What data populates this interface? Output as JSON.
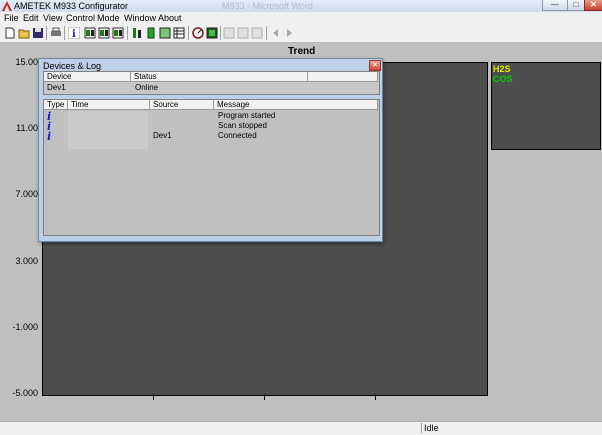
{
  "window": {
    "title": "AMETEK M933 Configurator",
    "ghost_title": "M933 - Microsoft Word",
    "minimize": "—",
    "maximize": "□",
    "close": "✕"
  },
  "menu": [
    "File",
    "Edit",
    "View",
    "Control",
    "Mode",
    "Window",
    "About"
  ],
  "toolbar": {
    "icons": [
      "new-file-icon",
      "open-folder-icon",
      "save-icon",
      "print-icon",
      "info-icon",
      "channel-1-icon",
      "channel-2-icon",
      "channel-3-icon",
      "bar-chart-icon",
      "green-cell-icon",
      "table-icon",
      "grid-icon",
      "gauge-icon",
      "analyzer-icon",
      "disabled-a-icon",
      "disabled-b-icon",
      "disabled-c-icon",
      "left-arrow-icon",
      "right-arrow-icon"
    ]
  },
  "chart": {
    "title": "Trend",
    "y_ticks": [
      "15.00",
      "11.00",
      "7.000",
      "3.000",
      "-1.000",
      "-5.000"
    ],
    "background": "#4d4d4d"
  },
  "legend": [
    {
      "label": "H2S",
      "color": "#e6e600"
    },
    {
      "label": "COS",
      "color": "#00d000"
    }
  ],
  "status": {
    "state": "Idle"
  },
  "dialog": {
    "title": "Devices & Log",
    "close": "✕",
    "devices": {
      "headers": [
        "Device",
        "Status"
      ],
      "rows": [
        {
          "device": "Dev1",
          "status": "Online"
        }
      ]
    },
    "log": {
      "headers": [
        "Type",
        "Time",
        "Source",
        "Message"
      ],
      "rows": [
        {
          "source": "",
          "message": "Program started"
        },
        {
          "source": "",
          "message": "Scan stopped"
        },
        {
          "source": "Dev1",
          "message": "Connected"
        }
      ]
    }
  }
}
